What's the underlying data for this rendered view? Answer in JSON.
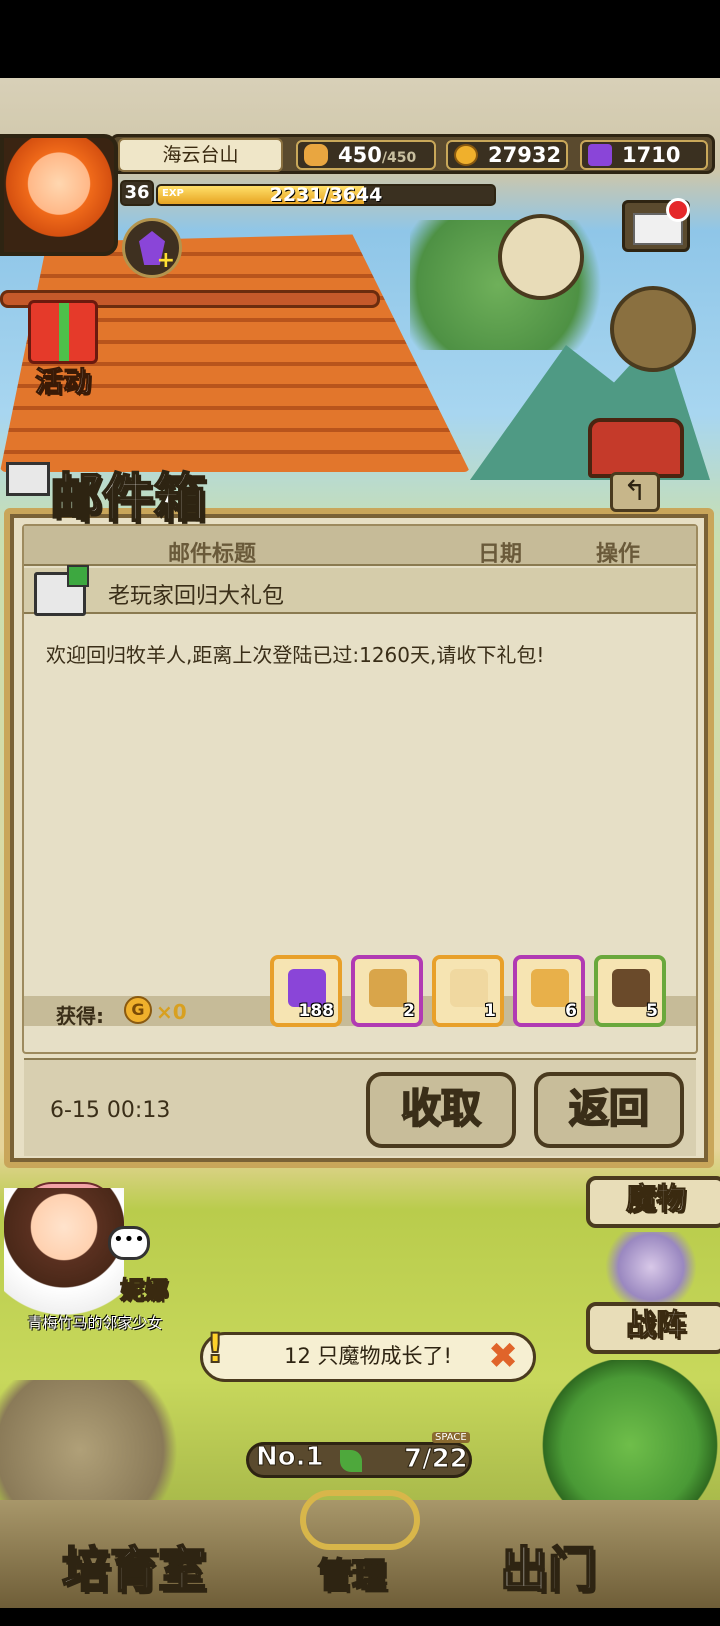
{
  "player": {
    "name": "海云台山",
    "level": "36",
    "exp_label": "EXP",
    "exp_text": "2231/3644",
    "exp_fraction": 0.612
  },
  "resources": {
    "stamina": "450",
    "stamina_max": "/450",
    "gold": "27932",
    "gems": "1710"
  },
  "event": {
    "label": "活动"
  },
  "mailbox": {
    "title": "邮件箱",
    "columns": [
      "邮件标题",
      "日期",
      "操作"
    ],
    "subject": "老玩家回归大礼包",
    "body": "欢迎回归牧羊人,距离上次登陆已过:1260天,请收下礼包!",
    "reward_label": "获得:",
    "coin_symbol": "G",
    "coin_count": "×0",
    "items": [
      {
        "name": "purple-gem",
        "count": "188",
        "border": "#e8a02a",
        "color": "#8a45d8"
      },
      {
        "name": "bread-sack",
        "count": "2",
        "border": "#b13ab3",
        "color": "#d9a54a"
      },
      {
        "name": "ticket",
        "count": "1",
        "border": "#e8a02a",
        "color": "#f0d8a0"
      },
      {
        "name": "bread-basket",
        "count": "6",
        "border": "#b13ab3",
        "color": "#e8b04a"
      },
      {
        "name": "pickaxe",
        "count": "5",
        "border": "#6aa83c",
        "color": "#6a4a2a"
      }
    ],
    "date": "6-15 00:13",
    "collect_label": "收取",
    "return_label": "返回"
  },
  "npc": {
    "name": "妮娜",
    "subtitle": "青梅竹马的邻家少女",
    "chat_icon": "•••"
  },
  "side": {
    "monster": "魔物",
    "formation": "战阵"
  },
  "notice": {
    "text": "12 只魔物成长了!",
    "exclaim": "!",
    "close": "✖"
  },
  "ranch": {
    "no_label": "No.1",
    "space_label": "SPACE",
    "space_count": "7/22"
  },
  "nav": {
    "nursery": "培育室",
    "manage": "管理",
    "exit": "出门"
  }
}
